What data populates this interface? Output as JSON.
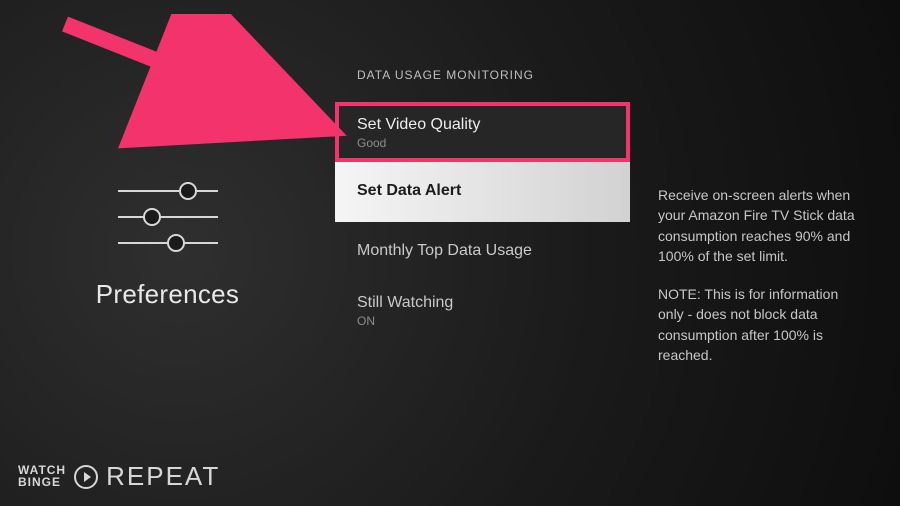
{
  "page": {
    "title": "Preferences"
  },
  "section": {
    "label": "DATA USAGE MONITORING"
  },
  "items": [
    {
      "title": "Set Video Quality",
      "sub": "Good"
    },
    {
      "title": "Set Data Alert",
      "sub": ""
    },
    {
      "title": "Monthly Top Data Usage",
      "sub": ""
    },
    {
      "title": "Still Watching",
      "sub": "ON"
    }
  ],
  "help": {
    "p1": "Receive on-screen alerts when your Amazon Fire TV Stick data consumption reaches 90% and 100% of the set limit.",
    "p2": "NOTE: This is for information only - does not block data consumption after 100% is reached."
  },
  "watermark": {
    "line1": "WATCH",
    "line2": "BINGE",
    "word": "REPEAT"
  },
  "colors": {
    "accent": "#f3336b"
  }
}
